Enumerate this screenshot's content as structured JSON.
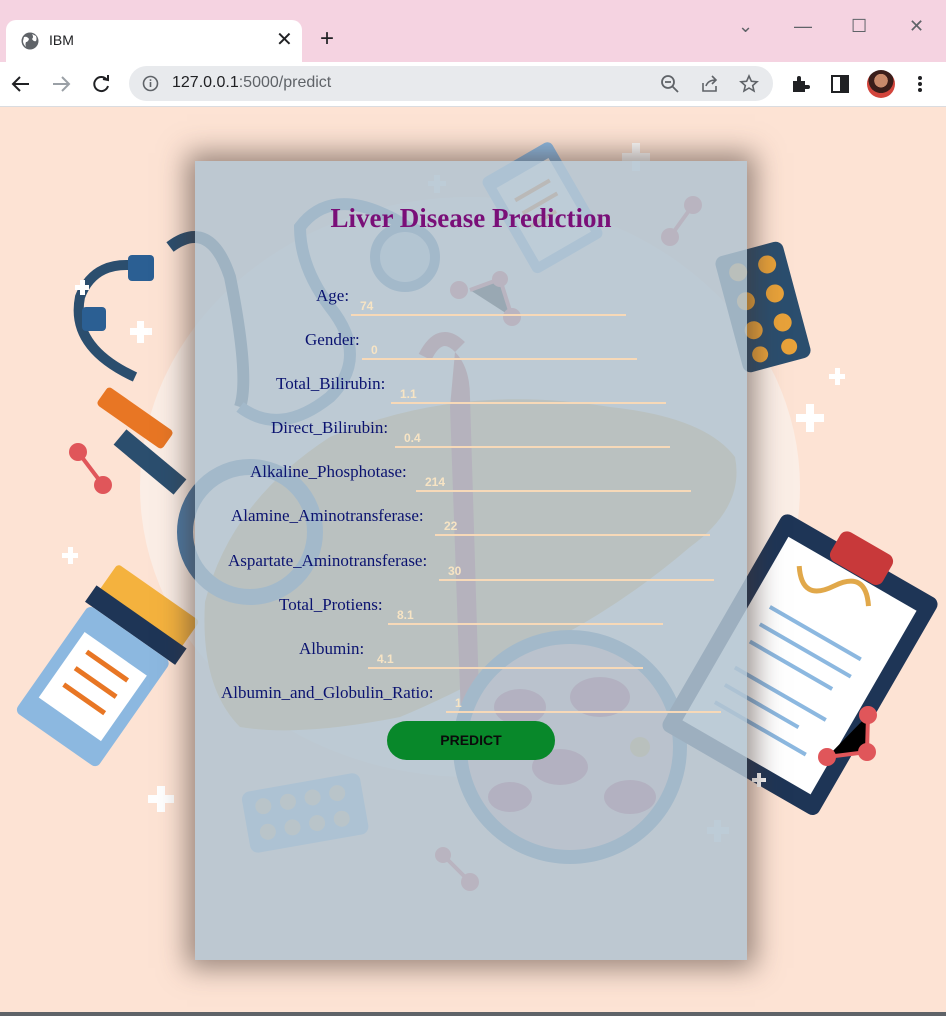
{
  "browser": {
    "tab_title": "IBM",
    "tab_close": "✕",
    "new_tab": "+",
    "url_host": "127.0.0.1",
    "url_path": ":5000/predict",
    "window_controls": [
      "⌄",
      "—",
      "☐",
      "✕"
    ]
  },
  "form": {
    "title": "Liver Disease Prediction",
    "fields": [
      {
        "label": "Age:",
        "value": "74"
      },
      {
        "label": "Gender:",
        "value": "0"
      },
      {
        "label": "Total_Bilirubin:",
        "value": "1.1"
      },
      {
        "label": "Direct_Bilirubin:",
        "value": "0.4"
      },
      {
        "label": "Alkaline_Phosphotase:",
        "value": "214"
      },
      {
        "label": "Alamine_Aminotransferase:",
        "value": "22"
      },
      {
        "label": "Aspartate_Aminotransferase:",
        "value": "30"
      },
      {
        "label": "Total_Protiens:",
        "value": "8.1"
      },
      {
        "label": "Albumin:",
        "value": "4.1"
      },
      {
        "label": "Albumin_and_Globulin_Ratio:",
        "value": "1"
      }
    ],
    "button_label": "PREDICT"
  },
  "colors": {
    "tab_strip": "#f5d3e1",
    "page_background": "#fde3d4",
    "title": "#7a0f78",
    "label": "#0b1370",
    "button": "#08882a"
  },
  "icons": [
    "globe-icon",
    "close-icon",
    "plus-icon",
    "back-icon",
    "forward-icon",
    "reload-icon",
    "info-icon",
    "zoom-out-icon",
    "share-icon",
    "star-icon",
    "extensions-icon",
    "sidepanel-icon",
    "menu-icon"
  ]
}
